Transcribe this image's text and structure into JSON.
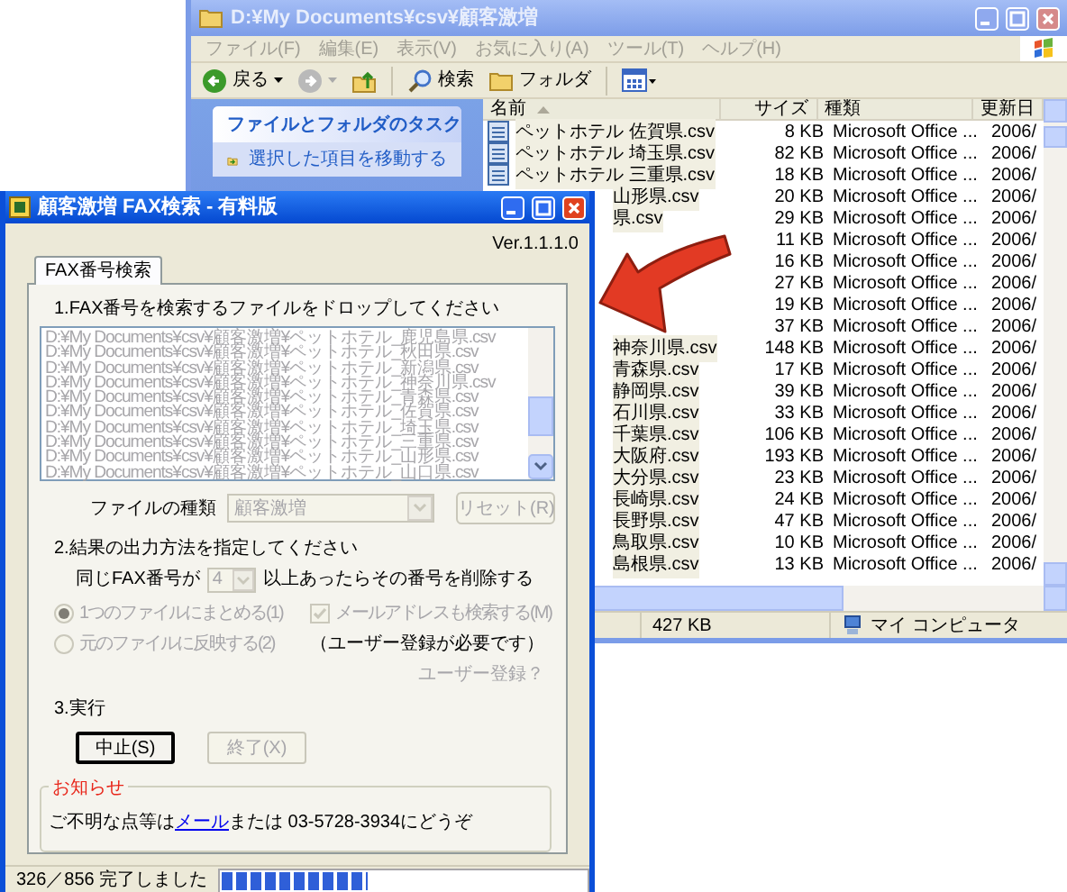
{
  "explorer": {
    "title": "D:¥My Documents¥csv¥顧客激増",
    "menu": [
      "ファイル(F)",
      "編集(E)",
      "表示(V)",
      "お気に入り(A)",
      "ツール(T)",
      "ヘルプ(H)"
    ],
    "toolbar": [
      {
        "kind": "back",
        "label": "戻る"
      },
      {
        "kind": "forward"
      },
      {
        "kind": "up"
      },
      {
        "kind": "search",
        "label": "検索"
      },
      {
        "kind": "folders",
        "label": "フォルダ"
      },
      {
        "kind": "views"
      }
    ],
    "task_pane": {
      "title": "ファイルとフォルダのタスク",
      "items": [
        "選択した項目を移動する"
      ]
    },
    "columns": [
      "名前",
      "サイズ",
      "種類",
      "更新日"
    ],
    "files": [
      {
        "name": "ペットホテル 佐賀県.csv",
        "size": "8 KB",
        "type": "Microsoft Office ...",
        "modified": "2006/",
        "icon": true
      },
      {
        "name": "ペットホテル 埼玉県.csv",
        "size": "82 KB",
        "type": "Microsoft Office ...",
        "modified": "2006/",
        "icon": true
      },
      {
        "name": "ペットホテル 三重県.csv",
        "size": "18 KB",
        "type": "Microsoft Office ...",
        "modified": "2006/",
        "icon": true
      },
      {
        "name": "山形県.csv",
        "size": "20 KB",
        "type": "Microsoft Office ...",
        "modified": "2006/",
        "icon": false
      },
      {
        "name": "県.csv",
        "size": "29 KB",
        "type": "Microsoft Office ...",
        "modified": "2006/",
        "icon": false
      },
      {
        "size": "11 KB",
        "type": "Microsoft Office ...",
        "modified": "2006/",
        "icon": false
      },
      {
        "size": "16 KB",
        "type": "Microsoft Office ...",
        "modified": "2006/",
        "icon": false
      },
      {
        "size": "27 KB",
        "type": "Microsoft Office ...",
        "modified": "2006/",
        "icon": false
      },
      {
        "size": "19 KB",
        "type": "Microsoft Office ...",
        "modified": "2006/",
        "icon": false
      },
      {
        "size": "37 KB",
        "type": "Microsoft Office ...",
        "modified": "2006/",
        "icon": false
      },
      {
        "name": "神奈川県.csv",
        "size": "148 KB",
        "type": "Microsoft Office ...",
        "modified": "2006/",
        "icon": false
      },
      {
        "name": "青森県.csv",
        "size": "17 KB",
        "type": "Microsoft Office ...",
        "modified": "2006/",
        "icon": false
      },
      {
        "name": "静岡県.csv",
        "size": "39 KB",
        "type": "Microsoft Office ...",
        "modified": "2006/",
        "icon": false
      },
      {
        "name": "石川県.csv",
        "size": "33 KB",
        "type": "Microsoft Office ...",
        "modified": "2006/",
        "icon": false
      },
      {
        "name": "千葉県.csv",
        "size": "106 KB",
        "type": "Microsoft Office ...",
        "modified": "2006/",
        "icon": false
      },
      {
        "name": "大阪府.csv",
        "size": "193 KB",
        "type": "Microsoft Office ...",
        "modified": "2006/",
        "icon": false
      },
      {
        "name": "大分県.csv",
        "size": "23 KB",
        "type": "Microsoft Office ...",
        "modified": "2006/",
        "icon": false
      },
      {
        "name": "長崎県.csv",
        "size": "24 KB",
        "type": "Microsoft Office ...",
        "modified": "2006/",
        "icon": false
      },
      {
        "name": "長野県.csv",
        "size": "47 KB",
        "type": "Microsoft Office ...",
        "modified": "2006/",
        "icon": false
      },
      {
        "name": "鳥取県.csv",
        "size": "10 KB",
        "type": "Microsoft Office ...",
        "modified": "2006/",
        "icon": false
      },
      {
        "name": "島根県.csv",
        "size": "13 KB",
        "type": "Microsoft Office ...",
        "modified": "2006/",
        "icon": false
      }
    ],
    "status": {
      "size": "427 KB",
      "location": "マイ コンピュータ"
    }
  },
  "dialog": {
    "title": "顧客激増 FAX検索 - 有料版",
    "version": "Ver.1.1.1.0",
    "tabs": [
      {
        "label": "FAX番号検索",
        "selected": true
      }
    ],
    "step1": {
      "label": "1.FAX番号を検索するファイルをドロップしてください",
      "disabled": true,
      "files": [
        "D:¥My Documents¥csv¥顧客激増¥ペットホテル_鹿児島県.csv",
        "D:¥My Documents¥csv¥顧客激増¥ペットホテル_秋田県.csv",
        "D:¥My Documents¥csv¥顧客激増¥ペットホテル_新潟県.csv",
        "D:¥My Documents¥csv¥顧客激増¥ペットホテル_神奈川県.csv",
        "D:¥My Documents¥csv¥顧客激増¥ペットホテル_青森県.csv",
        "D:¥My Documents¥csv¥顧客激増¥ペットホテル_佐賀県.csv",
        "D:¥My Documents¥csv¥顧客激増¥ペットホテル_埼玉県.csv",
        "D:¥My Documents¥csv¥顧客激増¥ペットホテル_三重県.csv",
        "D:¥My Documents¥csv¥顧客激増¥ペットホテル_山形県.csv",
        "D:¥My Documents¥csv¥顧客激増¥ペットホテル_山口県.csv"
      ]
    },
    "file_type": {
      "label": "ファイルの種類",
      "value": "顧客激増",
      "disabled": true
    },
    "reset_button": {
      "label": "リセット(R)",
      "disabled": true
    },
    "step2": {
      "label": "2.結果の出力方法を指定してください",
      "dup_prefix": "同じFAX番号が",
      "dup_value": "4",
      "dup_disabled": true,
      "dup_suffix": "以上あったらその番号を削除する",
      "options": [
        {
          "label": "1つのファイルにまとめる(1)",
          "selected": true,
          "disabled": true
        },
        {
          "label": "元のファイルに反映する(2)",
          "selected": false,
          "disabled": true
        }
      ],
      "email_search": {
        "label": "メールアドレスも検索する(M)",
        "checked": true,
        "disabled": true
      },
      "registration_note": "（ユーザー登録が必要です）",
      "registration_link": "ユーザー登録？"
    },
    "step3": {
      "label": "3.実行",
      "buttons": [
        {
          "label": "中止(S)",
          "disabled": false
        },
        {
          "label": "終了(X)",
          "disabled": true
        }
      ]
    },
    "notice": {
      "title": "お知らせ",
      "before": "ご不明な点等は",
      "link": "メール",
      "after": "または 03-5728-3934にどうぞ"
    },
    "status": {
      "text": "326／856 完了しました",
      "level": 0.4
    }
  }
}
